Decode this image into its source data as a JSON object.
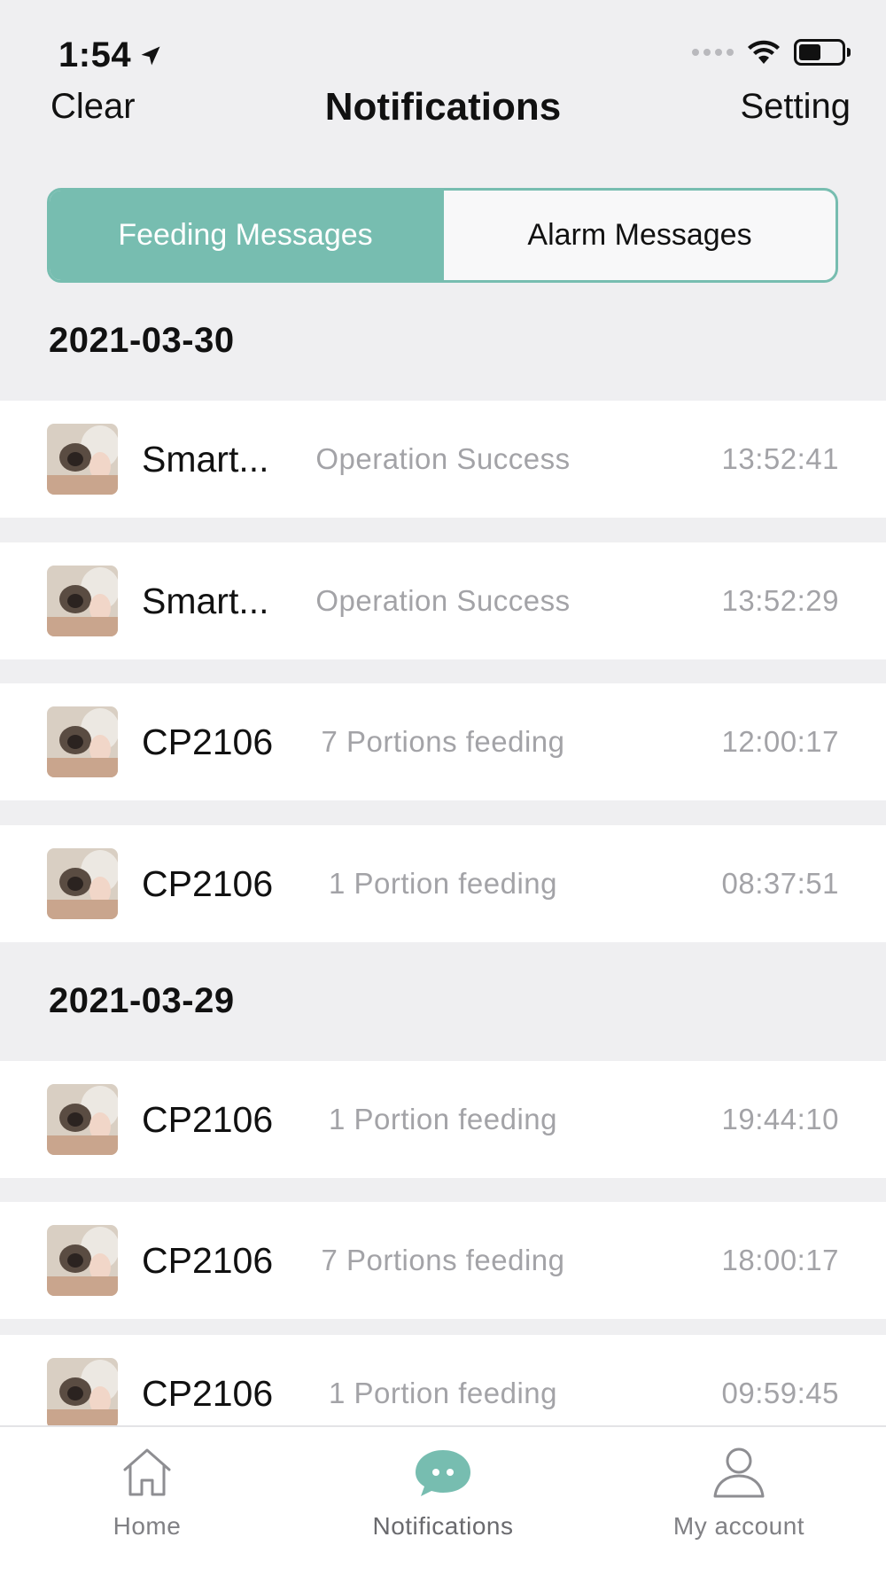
{
  "status_bar": {
    "time": "1:54"
  },
  "nav": {
    "left": "Clear",
    "title": "Notifications",
    "right": "Setting"
  },
  "tabs": [
    {
      "label": "Feeding Messages",
      "active": true
    },
    {
      "label": "Alarm Messages",
      "active": false
    }
  ],
  "groups": [
    {
      "date": "2021-03-30",
      "items": [
        {
          "device": "Smart...",
          "message": "Operation Success",
          "time": "13:52:41"
        },
        {
          "device": "Smart...",
          "message": "Operation Success",
          "time": "13:52:29"
        },
        {
          "device": "CP2106",
          "message": "7 Portions feeding",
          "time": "12:00:17"
        },
        {
          "device": "CP2106",
          "message": "1 Portion feeding",
          "time": "08:37:51"
        }
      ]
    },
    {
      "date": "2021-03-29",
      "items": [
        {
          "device": "CP2106",
          "message": "1 Portion feeding",
          "time": "19:44:10"
        },
        {
          "device": "CP2106",
          "message": "7 Portions feeding",
          "time": "18:00:17"
        },
        {
          "device": "CP2106",
          "message": "1 Portion feeding",
          "time": "09:59:45"
        }
      ]
    }
  ],
  "tab_bar": [
    {
      "label": "Home",
      "icon": "home-icon",
      "active": false
    },
    {
      "label": "Notifications",
      "icon": "chat-bubble-icon",
      "active": true
    },
    {
      "label": "My account",
      "icon": "person-icon",
      "active": false
    }
  ],
  "colors": {
    "accent": "#77bdb0",
    "background": "#efeff1",
    "muted_text": "#a3a3a7"
  }
}
